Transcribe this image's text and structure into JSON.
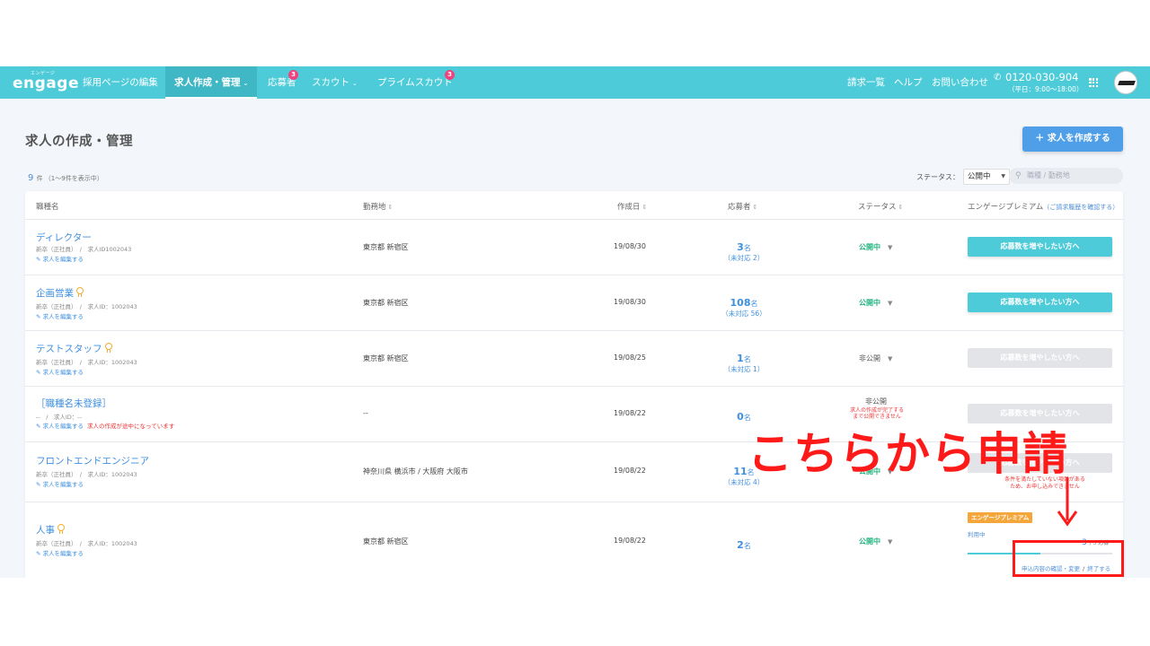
{
  "header": {
    "logo_ruby": "エンゲージ",
    "logo_text": "engage",
    "nav": [
      {
        "label": "採用ページの編集"
      },
      {
        "label": "求人作成・管理"
      },
      {
        "label": "応募者",
        "badge": "3"
      },
      {
        "label": "スカウト"
      },
      {
        "label": "プライムスカウト",
        "badge": "3"
      }
    ],
    "right_links": [
      "請求一覧",
      "ヘルプ",
      "お問い合わせ"
    ],
    "phone": "0120-030-904",
    "phone_hours": "（平日：9:00〜18:00）",
    "icons": {
      "phone": "phone-icon",
      "apps": "apps-grid-icon",
      "avatar": "company-avatar"
    }
  },
  "page": {
    "title": "求人の作成・管理",
    "create_button": "＋ 求人を作成する",
    "count": "9",
    "count_unit": "件 （1〜9件を表示中）",
    "status_label": "ステータス：",
    "status_value": "公開中",
    "search_placeholder": "職種 / 勤務地"
  },
  "table": {
    "headers": {
      "job": "職種名",
      "location": "勤務地",
      "created": "作成日",
      "applicants": "応募者",
      "status": "ステータス",
      "premium": "エンゲージプレミアム",
      "premium_note": "（ご請求履歴を確認する）"
    },
    "rows": [
      {
        "title": "ディレクター",
        "meta": "新卒（正社員）　/　求人ID1002043",
        "edit": "求人を編集する",
        "location": "東京都 新宿区",
        "date": "19/08/30",
        "applicants": "3",
        "unit": "名",
        "pending": "（未対応 2）",
        "status": "公開中",
        "premium_button": "応募数を増やしたい方へ"
      },
      {
        "title": "企画営業",
        "meta": "新卒（正社員）　/　求人ID：1002043",
        "edit": "求人を編集する",
        "location": "東京都 新宿区",
        "date": "19/08/30",
        "applicants": "108",
        "unit": "名",
        "pending": "（未対応 56）",
        "status": "公開中",
        "premium_button": "応募数を増やしたい方へ"
      },
      {
        "title": "テストスタッフ",
        "meta": "新卒（正社員）　/　求人ID：1002043",
        "edit": "求人を編集する",
        "location": "東京都 新宿区",
        "date": "19/08/25",
        "applicants": "1",
        "unit": "名",
        "pending": "（未対応 1）",
        "status": "非公開",
        "premium_button": "応募数を増やしたい方へ"
      },
      {
        "title": "［職種名未登録］",
        "meta": "--　/　求人ID：--",
        "edit": "求人を編集する",
        "warning": "求人の作成が途中になっています",
        "location": "--",
        "date": "19/08/22",
        "applicants": "0",
        "unit": "名",
        "status": "非公開",
        "status_note": "求人の作成が完了する\nまで公開できません",
        "premium_button": "応募数を増やしたい方へ"
      },
      {
        "title": "フロントエンドエンジニア",
        "meta": "新卒（正社員）　/　求人ID：1002043",
        "edit": "求人を編集する",
        "location": "神奈川県 横浜市 / 大阪府 大阪市",
        "date": "19/08/22",
        "applicants": "11",
        "unit": "名",
        "pending": "（未対応 4）",
        "status": "公開中",
        "premium_button": "応募数を増やしたい方へ",
        "condition_note": "条件を満たしていない項目がある\nため、お申し込みできません"
      },
      {
        "title": "人事",
        "meta": "新卒（正社員）　/　求人ID：1002043",
        "edit": "求人を編集する",
        "location": "東京都 新宿区",
        "date": "19/08/22",
        "applicants": "2",
        "unit": "名",
        "status": "公開中",
        "premium_tag": "エンゲージプレミアム",
        "premium_state": "利用中",
        "premium_count": "3",
        "premium_count_unit": "/ 5 応募",
        "premium_progress": 0.5,
        "link_change": "申込内容の確認・変更",
        "link_end": "終了する"
      }
    ]
  },
  "annotation": {
    "text": "こちらから申請",
    "color": "#ff1a1a"
  },
  "colors": {
    "header": "#4ecbd8",
    "accent_blue": "#3d8fe0",
    "published": "#1fb37f",
    "premium_tag": "#f5a63a"
  }
}
